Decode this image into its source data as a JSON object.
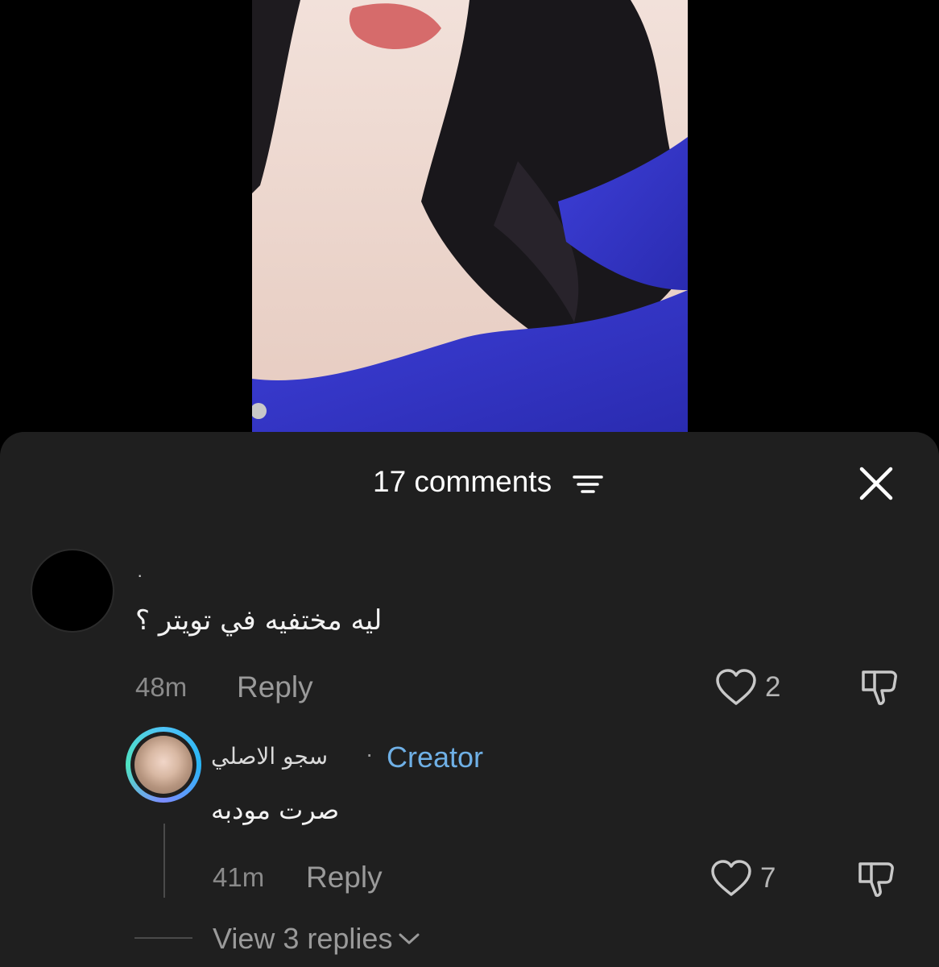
{
  "header": {
    "comment_count": "17 comments"
  },
  "icons": {
    "sort": "sort-lines-icon",
    "close": "close-icon",
    "like": "heart-icon",
    "dislike": "thumbs-down-icon",
    "expand": "chevron-down-icon"
  },
  "comments": [
    {
      "username": "·",
      "text": "ليه مختفيه في تويتر ؟",
      "time": "48m",
      "reply_label": "Reply",
      "likes": "2"
    }
  ],
  "reply": {
    "username": "سجو الاصلي",
    "separator": "·",
    "badge": "Creator",
    "text": "صرت مودبه",
    "time": "41m",
    "reply_label": "Reply",
    "likes": "7"
  },
  "view_replies": "View 3 replies",
  "colors": {
    "sheet_bg": "#1f1f1f",
    "creator": "#6fb0e6",
    "muted": "#8a8a8a"
  }
}
